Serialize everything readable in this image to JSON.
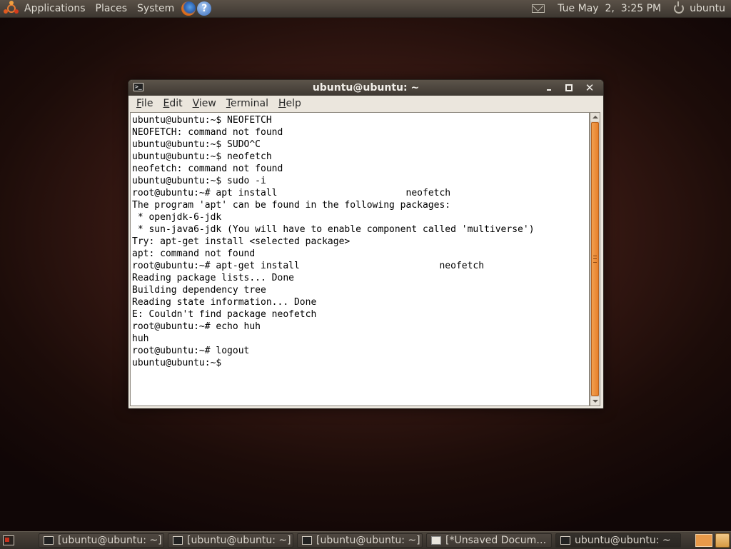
{
  "top_panel": {
    "menus": [
      "Applications",
      "Places",
      "System"
    ],
    "clock": "Tue May  2,  3:25 PM",
    "user": "ubuntu"
  },
  "terminal": {
    "title": "ubuntu@ubuntu: ~",
    "menu": [
      {
        "mnemonic": "F",
        "rest": "ile"
      },
      {
        "mnemonic": "E",
        "rest": "dit"
      },
      {
        "mnemonic": "V",
        "rest": "iew"
      },
      {
        "mnemonic": "T",
        "rest": "erminal"
      },
      {
        "mnemonic": "H",
        "rest": "elp"
      }
    ],
    "output": "ubuntu@ubuntu:~$ NEOFETCH\nNEOFETCH: command not found\nubuntu@ubuntu:~$ SUDO^C\nubuntu@ubuntu:~$ neofetch\nneofetch: command not found\nubuntu@ubuntu:~$ sudo -i\nroot@ubuntu:~# apt install                       neofetch\nThe program 'apt' can be found in the following packages:\n * openjdk-6-jdk\n * sun-java6-jdk (You will have to enable component called 'multiverse')\nTry: apt-get install <selected package>\napt: command not found\nroot@ubuntu:~# apt-get install                         neofetch\nReading package lists... Done\nBuilding dependency tree\nReading state information... Done\nE: Couldn't find package neofetch\nroot@ubuntu:~# echo huh\nhuh\nroot@ubuntu:~# logout\nubuntu@ubuntu:~$ "
  },
  "taskbar": {
    "tasks": [
      {
        "label": "[ubuntu@ubuntu: ~]",
        "icon": "terminal-icon"
      },
      {
        "label": "[ubuntu@ubuntu: ~]",
        "icon": "terminal-icon"
      },
      {
        "label": "[ubuntu@ubuntu: ~]",
        "icon": "terminal-icon"
      },
      {
        "label": "[*Unsaved Docume...",
        "icon": "document-icon"
      },
      {
        "label": "ubuntu@ubuntu: ~",
        "icon": "terminal-icon"
      }
    ]
  },
  "colors": {
    "scrollbar_thumb": "#e8802a",
    "panel": "#3d3731"
  }
}
